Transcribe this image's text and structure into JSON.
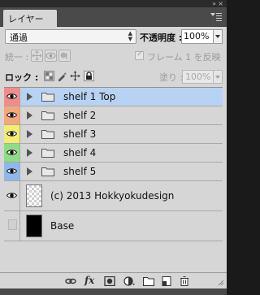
{
  "panel": {
    "tab_label": "レイヤー",
    "collapse_glyph": "»",
    "close_glyph": "×"
  },
  "blend": {
    "mode": "通過",
    "opacity_label": "不透明度 :",
    "opacity_value": "100%"
  },
  "unify": {
    "label": "統一 :",
    "propagate_label": "フレーム 1 を反映",
    "propagate_checked": true
  },
  "lock": {
    "label": "ロック :",
    "fill_label": "塗り :",
    "fill_value": "100%"
  },
  "layers": [
    {
      "name": "shelf 1 Top",
      "type": "group",
      "visible": true,
      "color": "#f08c8c",
      "selected": true
    },
    {
      "name": "shelf 2",
      "type": "group",
      "visible": true,
      "color": "#f5a77c",
      "selected": false
    },
    {
      "name": "shelf 3",
      "type": "group",
      "visible": true,
      "color": "#f2ee74",
      "selected": false
    },
    {
      "name": "shelf 4",
      "type": "group",
      "visible": true,
      "color": "#8fdc86",
      "selected": false
    },
    {
      "name": "shelf 5",
      "type": "group",
      "visible": true,
      "color": "#8fb8ea",
      "selected": false
    },
    {
      "name": "(c) 2013 Hokkyokudesign",
      "type": "layer",
      "visible": true,
      "thumbnail": "transparent",
      "selected": false
    },
    {
      "name": "Base",
      "type": "layer",
      "visible": false,
      "thumbnail": "black",
      "selected": false
    }
  ],
  "bottom_toolbar": {
    "items": [
      "link-layers-icon",
      "fx-icon",
      "add-mask-icon",
      "adjustment-layer-icon",
      "new-group-icon",
      "new-layer-icon",
      "delete-layer-icon"
    ],
    "fx_label": "fx"
  }
}
